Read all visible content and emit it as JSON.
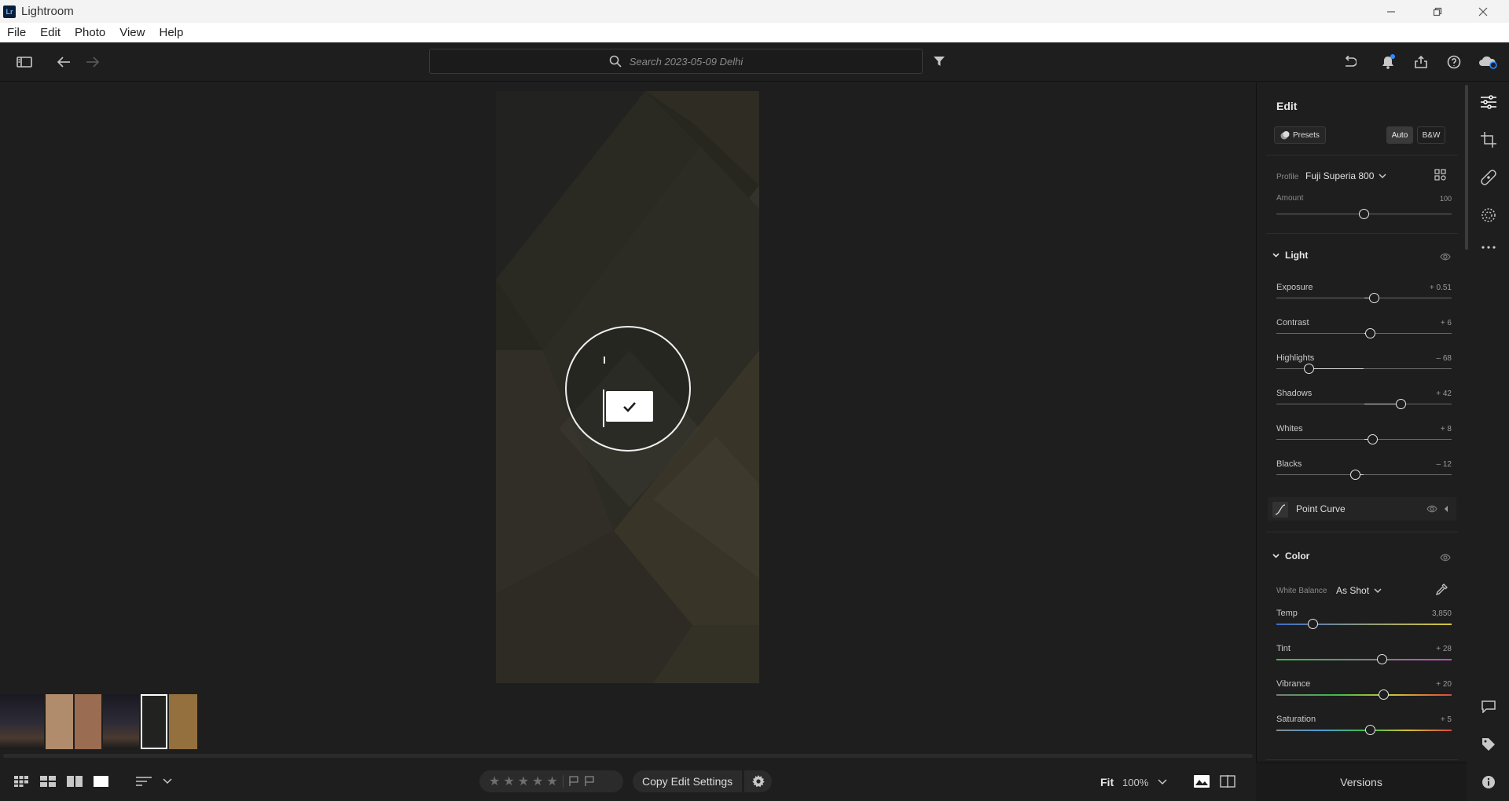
{
  "app": {
    "title": "Lightroom",
    "logo": "Lr"
  },
  "menu": [
    "File",
    "Edit",
    "Photo",
    "View",
    "Help"
  ],
  "search": {
    "placeholder": "Search 2023-05-09 Delhi"
  },
  "edit_panel": {
    "title": "Edit",
    "presets_label": "Presets",
    "auto_label": "Auto",
    "bw_label": "B&W",
    "profile_label": "Profile",
    "profile_value": "Fuji Superia 800",
    "amount_label": "Amount",
    "amount_value": "100",
    "amount_level": 0.5,
    "light": {
      "title": "Light",
      "sliders": [
        {
          "label": "Exposure",
          "value": "+ 0.51",
          "level": 0.557
        },
        {
          "label": "Contrast",
          "value": "+ 6",
          "level": 0.535
        },
        {
          "label": "Highlights",
          "value": "– 68",
          "level": 0.186
        },
        {
          "label": "Shadows",
          "value": "+ 42",
          "level": 0.712
        },
        {
          "label": "Whites",
          "value": "+ 8",
          "level": 0.548
        },
        {
          "label": "Blacks",
          "value": "– 12",
          "level": 0.452
        }
      ]
    },
    "point_curve_label": "Point Curve",
    "color": {
      "title": "Color",
      "white_balance_label": "White Balance",
      "white_balance_value": "As Shot",
      "sliders": [
        {
          "label": "Temp",
          "value": "3,850",
          "level": 0.207,
          "track": "temp"
        },
        {
          "label": "Tint",
          "value": "+ 28",
          "level": 0.603,
          "track": "tint"
        },
        {
          "label": "Vibrance",
          "value": "+ 20",
          "level": 0.61,
          "track": "vib"
        },
        {
          "label": "Saturation",
          "value": "+ 5",
          "level": 0.538,
          "track": "sat"
        }
      ]
    },
    "versions_label": "Versions"
  },
  "bottom_bar": {
    "copy_edit_label": "Copy Edit Settings",
    "fit_label": "Fit",
    "zoom_label": "100%",
    "stars": 5
  },
  "filmstrip": {
    "selected_index": 4,
    "thumbs": [
      {
        "name": "night-street-1",
        "color": "#2a2630"
      },
      {
        "name": "beige-wall",
        "color": "#b08c6c"
      },
      {
        "name": "brown-wall",
        "color": "#9a6c52"
      },
      {
        "name": "night-street-2",
        "color": "#2a2838"
      },
      {
        "name": "dark-pattern",
        "color": "#222220"
      },
      {
        "name": "tan-texture",
        "color": "#94703e"
      }
    ]
  }
}
